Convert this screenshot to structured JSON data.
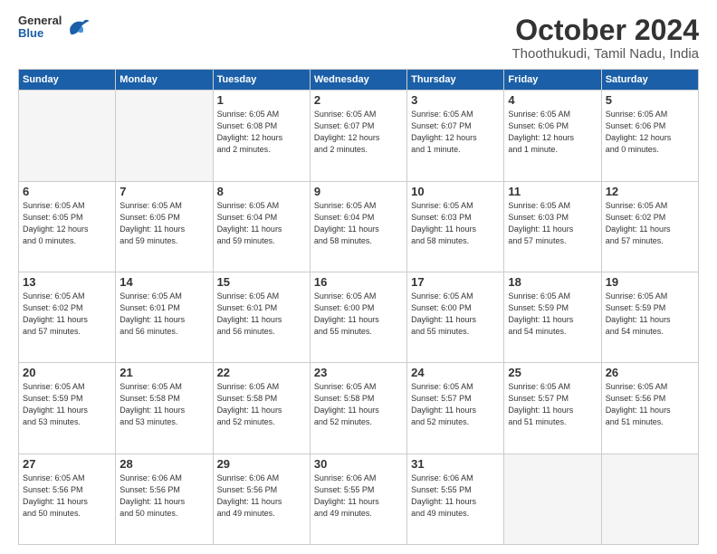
{
  "logo": {
    "general": "General",
    "blue": "Blue"
  },
  "header": {
    "month_title": "October 2024",
    "location": "Thoothukudi, Tamil Nadu, India"
  },
  "weekdays": [
    "Sunday",
    "Monday",
    "Tuesday",
    "Wednesday",
    "Thursday",
    "Friday",
    "Saturday"
  ],
  "weeks": [
    [
      {
        "day": "",
        "info": ""
      },
      {
        "day": "",
        "info": ""
      },
      {
        "day": "1",
        "info": "Sunrise: 6:05 AM\nSunset: 6:08 PM\nDaylight: 12 hours\nand 2 minutes."
      },
      {
        "day": "2",
        "info": "Sunrise: 6:05 AM\nSunset: 6:07 PM\nDaylight: 12 hours\nand 2 minutes."
      },
      {
        "day": "3",
        "info": "Sunrise: 6:05 AM\nSunset: 6:07 PM\nDaylight: 12 hours\nand 1 minute."
      },
      {
        "day": "4",
        "info": "Sunrise: 6:05 AM\nSunset: 6:06 PM\nDaylight: 12 hours\nand 1 minute."
      },
      {
        "day": "5",
        "info": "Sunrise: 6:05 AM\nSunset: 6:06 PM\nDaylight: 12 hours\nand 0 minutes."
      }
    ],
    [
      {
        "day": "6",
        "info": "Sunrise: 6:05 AM\nSunset: 6:05 PM\nDaylight: 12 hours\nand 0 minutes."
      },
      {
        "day": "7",
        "info": "Sunrise: 6:05 AM\nSunset: 6:05 PM\nDaylight: 11 hours\nand 59 minutes."
      },
      {
        "day": "8",
        "info": "Sunrise: 6:05 AM\nSunset: 6:04 PM\nDaylight: 11 hours\nand 59 minutes."
      },
      {
        "day": "9",
        "info": "Sunrise: 6:05 AM\nSunset: 6:04 PM\nDaylight: 11 hours\nand 58 minutes."
      },
      {
        "day": "10",
        "info": "Sunrise: 6:05 AM\nSunset: 6:03 PM\nDaylight: 11 hours\nand 58 minutes."
      },
      {
        "day": "11",
        "info": "Sunrise: 6:05 AM\nSunset: 6:03 PM\nDaylight: 11 hours\nand 57 minutes."
      },
      {
        "day": "12",
        "info": "Sunrise: 6:05 AM\nSunset: 6:02 PM\nDaylight: 11 hours\nand 57 minutes."
      }
    ],
    [
      {
        "day": "13",
        "info": "Sunrise: 6:05 AM\nSunset: 6:02 PM\nDaylight: 11 hours\nand 57 minutes."
      },
      {
        "day": "14",
        "info": "Sunrise: 6:05 AM\nSunset: 6:01 PM\nDaylight: 11 hours\nand 56 minutes."
      },
      {
        "day": "15",
        "info": "Sunrise: 6:05 AM\nSunset: 6:01 PM\nDaylight: 11 hours\nand 56 minutes."
      },
      {
        "day": "16",
        "info": "Sunrise: 6:05 AM\nSunset: 6:00 PM\nDaylight: 11 hours\nand 55 minutes."
      },
      {
        "day": "17",
        "info": "Sunrise: 6:05 AM\nSunset: 6:00 PM\nDaylight: 11 hours\nand 55 minutes."
      },
      {
        "day": "18",
        "info": "Sunrise: 6:05 AM\nSunset: 5:59 PM\nDaylight: 11 hours\nand 54 minutes."
      },
      {
        "day": "19",
        "info": "Sunrise: 6:05 AM\nSunset: 5:59 PM\nDaylight: 11 hours\nand 54 minutes."
      }
    ],
    [
      {
        "day": "20",
        "info": "Sunrise: 6:05 AM\nSunset: 5:59 PM\nDaylight: 11 hours\nand 53 minutes."
      },
      {
        "day": "21",
        "info": "Sunrise: 6:05 AM\nSunset: 5:58 PM\nDaylight: 11 hours\nand 53 minutes."
      },
      {
        "day": "22",
        "info": "Sunrise: 6:05 AM\nSunset: 5:58 PM\nDaylight: 11 hours\nand 52 minutes."
      },
      {
        "day": "23",
        "info": "Sunrise: 6:05 AM\nSunset: 5:58 PM\nDaylight: 11 hours\nand 52 minutes."
      },
      {
        "day": "24",
        "info": "Sunrise: 6:05 AM\nSunset: 5:57 PM\nDaylight: 11 hours\nand 52 minutes."
      },
      {
        "day": "25",
        "info": "Sunrise: 6:05 AM\nSunset: 5:57 PM\nDaylight: 11 hours\nand 51 minutes."
      },
      {
        "day": "26",
        "info": "Sunrise: 6:05 AM\nSunset: 5:56 PM\nDaylight: 11 hours\nand 51 minutes."
      }
    ],
    [
      {
        "day": "27",
        "info": "Sunrise: 6:05 AM\nSunset: 5:56 PM\nDaylight: 11 hours\nand 50 minutes."
      },
      {
        "day": "28",
        "info": "Sunrise: 6:06 AM\nSunset: 5:56 PM\nDaylight: 11 hours\nand 50 minutes."
      },
      {
        "day": "29",
        "info": "Sunrise: 6:06 AM\nSunset: 5:56 PM\nDaylight: 11 hours\nand 49 minutes."
      },
      {
        "day": "30",
        "info": "Sunrise: 6:06 AM\nSunset: 5:55 PM\nDaylight: 11 hours\nand 49 minutes."
      },
      {
        "day": "31",
        "info": "Sunrise: 6:06 AM\nSunset: 5:55 PM\nDaylight: 11 hours\nand 49 minutes."
      },
      {
        "day": "",
        "info": ""
      },
      {
        "day": "",
        "info": ""
      }
    ]
  ]
}
